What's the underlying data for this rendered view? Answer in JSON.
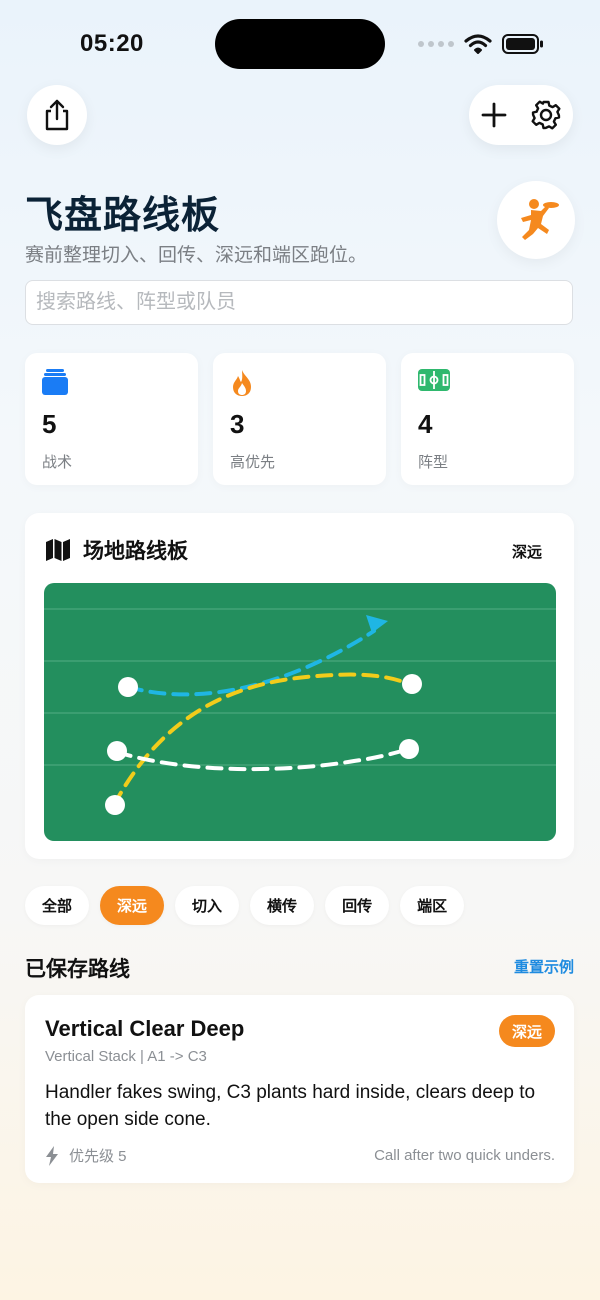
{
  "status": {
    "time": "05:20"
  },
  "header": {
    "title": "飞盘路线板",
    "subtitle": "赛前整理切入、回传、深远和端区跑位。",
    "share_icon": "share-icon",
    "add_icon": "plus-icon",
    "settings_icon": "gear-icon",
    "avatar_icon": "ultimate-player-icon"
  },
  "search": {
    "placeholder": "搜索路线、阵型或队员",
    "value": ""
  },
  "stats": [
    {
      "value": "5",
      "label": "战术",
      "icon": "stack-icon",
      "color": "#1a7cf5"
    },
    {
      "value": "3",
      "label": "高优先",
      "icon": "flame-icon",
      "color": "#f5891e"
    },
    {
      "value": "4",
      "label": "阵型",
      "icon": "field-icon",
      "color": "#2fb86e"
    }
  ],
  "board": {
    "title": "场地路线板",
    "tag": "深远",
    "icon": "map-icon",
    "colors": {
      "field": "#238f5e",
      "cyan": "#1fb6e3",
      "yellow": "#f2cc1b",
      "white": "#ffffff"
    }
  },
  "filters": [
    {
      "label": "全部",
      "active": false
    },
    {
      "label": "深远",
      "active": true
    },
    {
      "label": "切入",
      "active": false
    },
    {
      "label": "横传",
      "active": false
    },
    {
      "label": "回传",
      "active": false
    },
    {
      "label": "端区",
      "active": false
    }
  ],
  "saved": {
    "title": "已保存路线",
    "reset_label": "重置示例",
    "items": [
      {
        "title": "Vertical Clear Deep",
        "subtitle": "Vertical Stack | A1 -> C3",
        "badge": "深远",
        "description": "Handler fakes swing, C3 plants hard inside, clears deep to the open side cone.",
        "priority": "优先级 5",
        "priority_icon": "bolt-icon",
        "note": "Call after two quick unders."
      }
    ]
  },
  "accent": "#f5891e",
  "link_color": "#1f8be0"
}
